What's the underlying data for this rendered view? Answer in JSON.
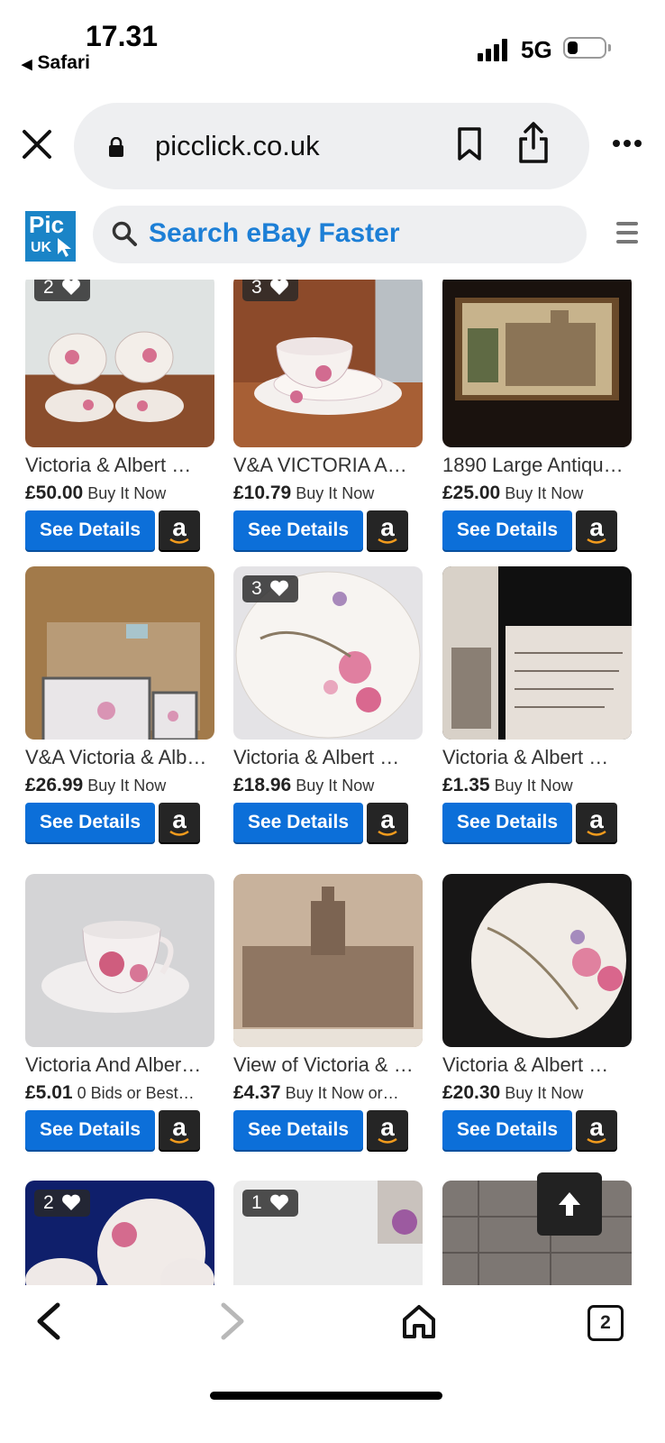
{
  "status": {
    "time": "17.31",
    "back_app": "Safari",
    "network": "5G"
  },
  "browser": {
    "url": "picclick.co.uk",
    "tab_count": "2"
  },
  "site": {
    "logo_line1": "Pic",
    "logo_line2": "UK",
    "search_placeholder": "Search eBay Faster"
  },
  "buttons": {
    "details_label": "See Details",
    "amazon_label": "a"
  },
  "listings": [
    {
      "title": "Victoria & Albert …",
      "price": "£50.00",
      "format": "Buy It Now",
      "watchers": "2"
    },
    {
      "title": "V&A VICTORIA A…",
      "price": "£10.79",
      "format": "Buy It Now",
      "watchers": "3"
    },
    {
      "title": "1890 Large Antiqu…",
      "price": "£25.00",
      "format": "Buy It Now",
      "watchers": ""
    },
    {
      "title": "V&A Victoria & Alb…",
      "price": "£26.99",
      "format": "Buy It Now",
      "watchers": ""
    },
    {
      "title": "Victoria & Albert …",
      "price": "£18.96",
      "format": "Buy It Now",
      "watchers": "3"
    },
    {
      "title": "Victoria & Albert …",
      "price": "£1.35",
      "format": "Buy It Now",
      "watchers": ""
    },
    {
      "title": "Victoria And Alber…",
      "price": "£5.01",
      "format": "0 Bids or Best…",
      "watchers": ""
    },
    {
      "title": "View of Victoria & …",
      "price": "£4.37",
      "format": "Buy It Now or…",
      "watchers": ""
    },
    {
      "title": "Victoria & Albert …",
      "price": "£20.30",
      "format": "Buy It Now",
      "watchers": ""
    },
    {
      "title": "",
      "price": "",
      "format": "",
      "watchers": "2"
    },
    {
      "title": "",
      "price": "",
      "format": "",
      "watchers": "1"
    },
    {
      "title": "",
      "price": "",
      "format": "",
      "watchers": ""
    }
  ],
  "colors": {
    "accent": "#0c6fd9",
    "search_text": "#1d7fd6",
    "logo_bg": "#1a84c7"
  }
}
